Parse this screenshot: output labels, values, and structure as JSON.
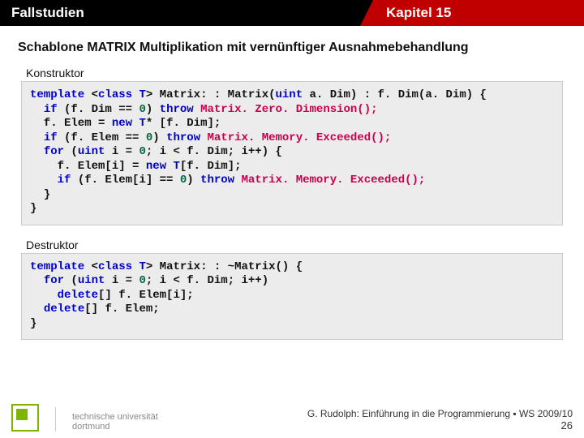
{
  "header": {
    "left": "Fallstudien",
    "right": "Kapitel 15"
  },
  "subtitle": "Schablone MATRIX Multiplikation mit vernünftiger Ausnahmebehandlung",
  "sections": {
    "konstruktor_label": "Konstruktor",
    "destruktor_label": "Destruktor"
  },
  "code": {
    "k": {
      "kw_template": "template",
      "kw_class": "class",
      "t": "T",
      "sig1_a": " Matrix: : Matrix(",
      "uint": "uint",
      "sig1_b": " a. Dim) : f. Dim(a. Dim) {",
      "kw_if": "if",
      "if1_cond": " (f. Dim == ",
      "zero": "0",
      "if1_close": ") ",
      "kw_throw": "throw",
      "ex_zero_dim": "Matrix. Zero. Dimension();",
      "line3_a": "  f. Elem = ",
      "kw_new": "new",
      "line3_b": "* [f. Dim];",
      "if2_cond": " (f. Elem == ",
      "if2_close": ") ",
      "ex_mem": "Matrix. Memory. Exceeded();",
      "kw_for": "for",
      "for_a": " (",
      "for_b": " i = ",
      "for_c": "; i < f. Dim; i++) {",
      "line6_a": "    f. Elem[i] = ",
      "line6_b": "[f. Dim];",
      "if3_cond": " (f. Elem[i] == ",
      "if3_close": ") ",
      "brace_close_inner": "  }",
      "brace_close_outer": "}"
    },
    "d": {
      "kw_template": "template",
      "kw_class": "class",
      "t": "T",
      "sig_a": " Matrix: : ~Matrix() {",
      "kw_for": "for",
      "for_a": " (",
      "uint": "uint",
      "for_b": " i = ",
      "zero": "0",
      "for_c": "; i < f. Dim; i++)",
      "kw_delete": "delete",
      "del_inner": "[] f. Elem[i];",
      "del_outer": "[] f. Elem;",
      "brace_close": "}"
    }
  },
  "footer": {
    "logo_line1": "technische universität",
    "logo_line2": "dortmund",
    "credit": "G. Rudolph: Einführung in die Programmierung ▪ WS 2009/10",
    "page": "26"
  }
}
